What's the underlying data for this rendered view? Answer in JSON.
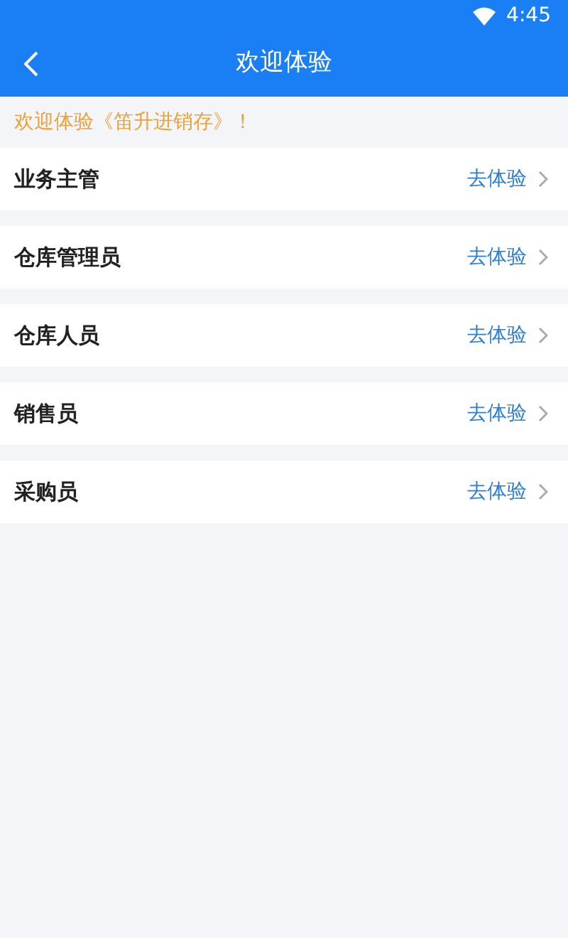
{
  "status_bar": {
    "time": "4:45"
  },
  "header": {
    "title": "欢迎体验"
  },
  "notice": "欢迎体验《笛升进销存》！",
  "roles": [
    {
      "name": "业务主管",
      "action": "去体验"
    },
    {
      "name": "仓库管理员",
      "action": "去体验"
    },
    {
      "name": "仓库人员",
      "action": "去体验"
    },
    {
      "name": "销售员",
      "action": "去体验"
    },
    {
      "name": "采购员",
      "action": "去体验"
    }
  ]
}
